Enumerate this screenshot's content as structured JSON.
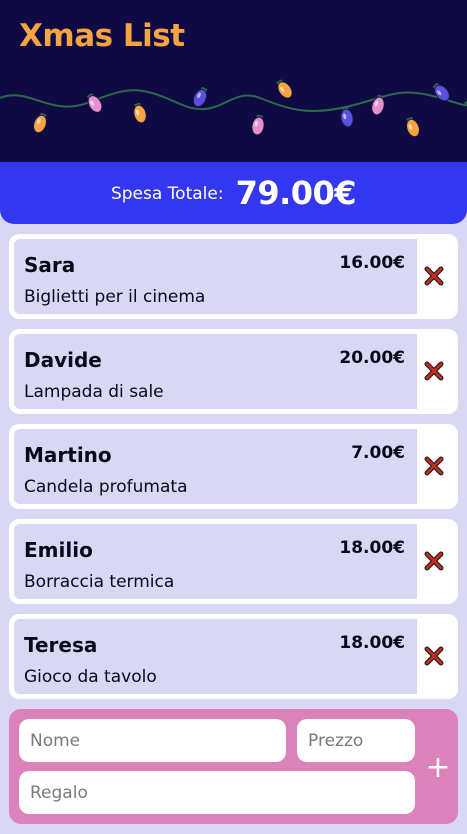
{
  "app": {
    "title": "Xmas List"
  },
  "summary": {
    "total_label": "Spesa Totale:",
    "total_value": "79.00€"
  },
  "items": [
    {
      "name": "Sara",
      "gift": "Biglietti per il cinema",
      "price": "16.00€"
    },
    {
      "name": "Davide",
      "gift": "Lampada di sale",
      "price": "20.00€"
    },
    {
      "name": "Martino",
      "gift": "Candela profumata",
      "price": "7.00€"
    },
    {
      "name": "Emilio",
      "gift": "Borraccia termica",
      "price": "18.00€"
    },
    {
      "name": "Teresa",
      "gift": "Gioco da tavolo",
      "price": "18.00€"
    }
  ],
  "form": {
    "name_placeholder": "Nome",
    "price_placeholder": "Prezzo",
    "gift_placeholder": "Regalo",
    "add_label": "+"
  },
  "icons": {
    "delete": "close-icon",
    "decoration": "christmas-lights"
  },
  "colors": {
    "header_bg": "#100a44",
    "title": "#f6a443",
    "total_bar": "#3437f0",
    "page_bg": "#d8d7f4",
    "form_bg": "#da82b9",
    "delete_icon": "#cc2a1e"
  }
}
